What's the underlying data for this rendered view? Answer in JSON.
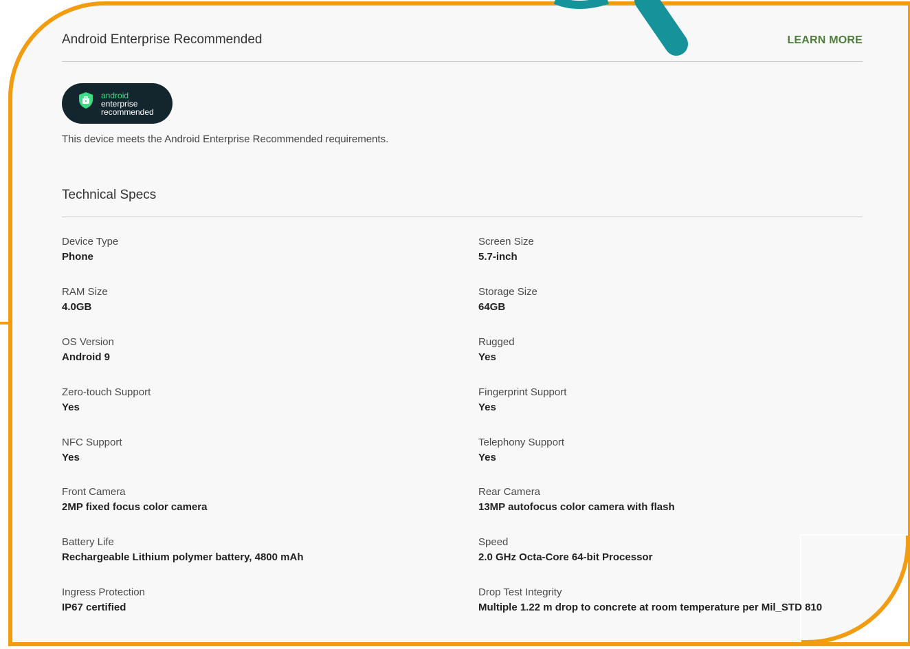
{
  "recommended_section": {
    "title": "Android Enterprise Recommended",
    "learn_more": "LEARN MORE",
    "badge": {
      "icon": "briefcase-shield-icon",
      "line1": "android",
      "line2": "enterprise",
      "line3": "recommended"
    },
    "statement": "This device meets the Android Enterprise Recommended requirements."
  },
  "specs_section": {
    "title": "Technical Specs",
    "left": [
      {
        "label": "Device Type",
        "value": "Phone"
      },
      {
        "label": "RAM Size",
        "value": "4.0GB"
      },
      {
        "label": "OS Version",
        "value": "Android 9"
      },
      {
        "label": "Zero-touch Support",
        "value": "Yes"
      },
      {
        "label": "NFC Support",
        "value": "Yes"
      },
      {
        "label": "Front Camera",
        "value": "2MP fixed focus color camera"
      },
      {
        "label": "Battery Life",
        "value": "Rechargeable Lithium polymer battery, 4800 mAh"
      },
      {
        "label": "Ingress Protection",
        "value": "IP67 certified"
      }
    ],
    "right": [
      {
        "label": "Screen Size",
        "value": "5.7-inch"
      },
      {
        "label": "Storage Size",
        "value": "64GB"
      },
      {
        "label": "Rugged",
        "value": "Yes"
      },
      {
        "label": "Fingerprint Support",
        "value": "Yes"
      },
      {
        "label": "Telephony Support",
        "value": "Yes"
      },
      {
        "label": "Rear Camera",
        "value": "13MP autofocus color camera with flash"
      },
      {
        "label": "Speed",
        "value": "2.0 GHz Octa-Core 64-bit Processor"
      },
      {
        "label": "Drop Test Integrity",
        "value": "Multiple 1.22 m drop to concrete at room temperature per Mil_STD 810"
      }
    ]
  },
  "colors": {
    "frame": "#f29c12",
    "pointer": "#16939a",
    "learn_more": "#4e7f3a",
    "badge_bg": "#13262d",
    "badge_accent": "#3ddc84"
  }
}
